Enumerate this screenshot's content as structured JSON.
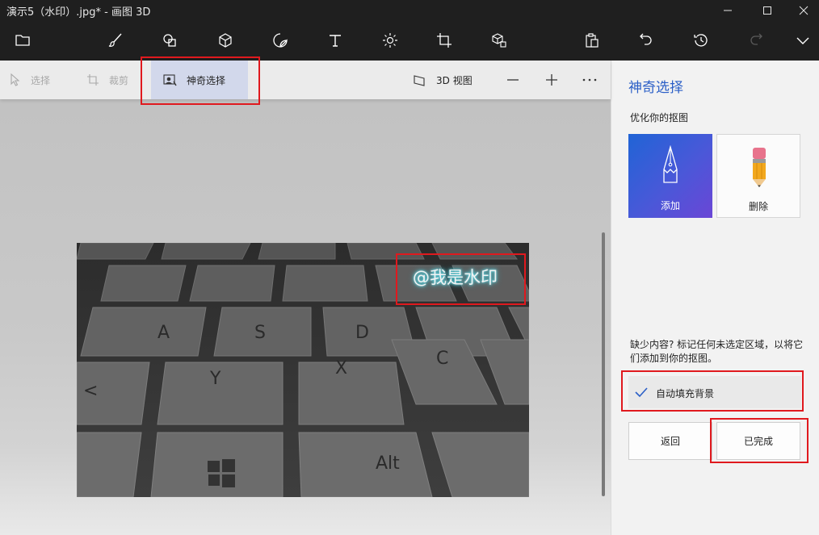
{
  "window": {
    "title": "演示5（水印）.jpg* - 画图 3D",
    "minimize_icon": "minimize-icon",
    "maximize_icon": "maximize-icon",
    "close_icon": "close-icon"
  },
  "toolbar": {
    "items": [
      "menu-folder-icon",
      "brush-icon",
      "2d-shapes-icon",
      "3d-shapes-icon",
      "stickers-icon",
      "text-icon",
      "effects-icon",
      "canvas-icon",
      "3d-library-icon",
      "paste-icon",
      "undo-icon",
      "history-icon",
      "redo-icon",
      "expand-icon"
    ]
  },
  "subtoolbar": {
    "select_label": "选择",
    "crop_label": "裁剪",
    "magic_select_label": "神奇选择",
    "view3d_label": "3D 视图",
    "zoom_out_icon": "minus-icon",
    "zoom_in_icon": "plus-icon",
    "more_icon": "more-icon"
  },
  "canvas": {
    "watermark_text": "@我是水印"
  },
  "panel": {
    "title": "神奇选择",
    "subtitle": "优化你的抠图",
    "add_label": "添加",
    "remove_label": "删除",
    "hint_text": "缺少内容? 标记任何未选定区域，以将它们添加到你的抠图。",
    "autofill_label": "自动填充背景",
    "autofill_checked": true,
    "back_label": "返回",
    "done_label": "已完成"
  },
  "colors": {
    "accent": "#2b5fc7",
    "highlight_box": "#e0191e",
    "toolbar_bg": "#1f1f1f",
    "active_tab_bg": "#d2d8eb"
  }
}
